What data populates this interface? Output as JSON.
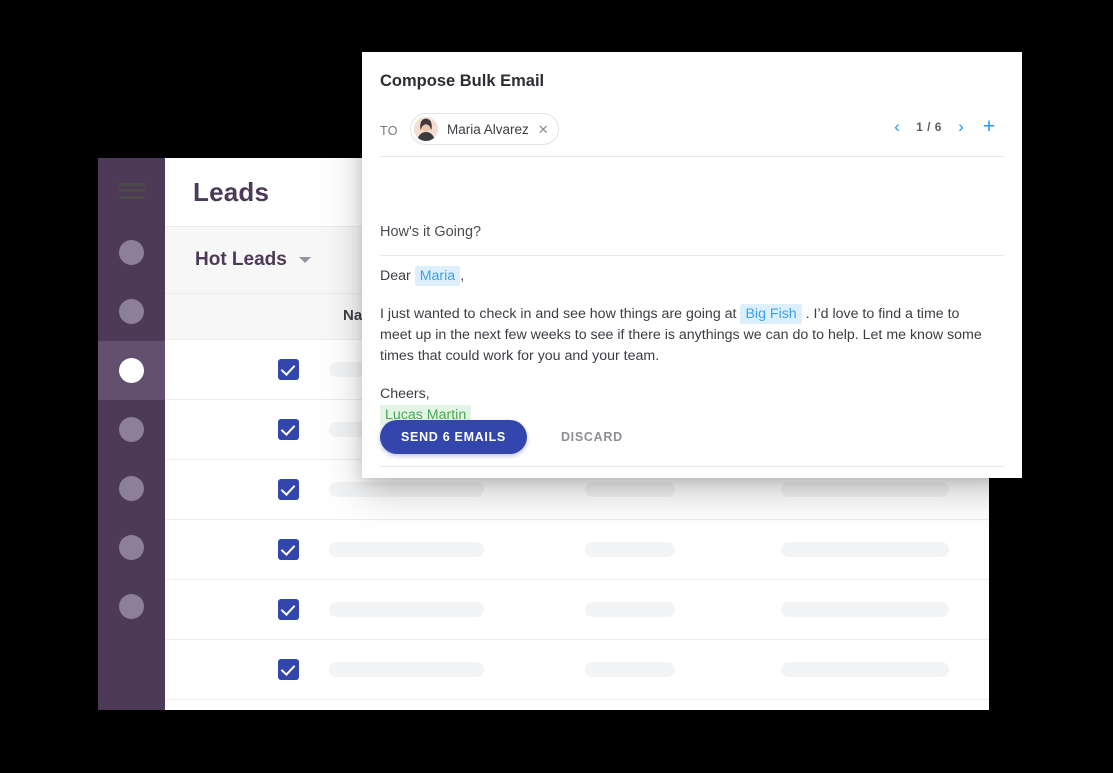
{
  "app": {
    "page_title": "Leads",
    "menu_icon": "hamburger-icon",
    "filter": {
      "label": "Hot Leads",
      "caret_icon": "chevron-down-icon"
    },
    "table": {
      "columns": [
        "Name"
      ],
      "row_count": 6,
      "rows_checked": true
    },
    "sidebar": {
      "items": [
        {
          "icon": "circle-avatar-icon",
          "active": false
        },
        {
          "icon": "circle-avatar-icon",
          "active": false
        },
        {
          "icon": "circle-avatar-icon",
          "active": true
        },
        {
          "icon": "circle-avatar-icon",
          "active": false
        },
        {
          "icon": "circle-avatar-icon",
          "active": false
        },
        {
          "icon": "circle-avatar-icon",
          "active": false
        },
        {
          "icon": "circle-avatar-icon",
          "active": false
        }
      ]
    }
  },
  "modal": {
    "title": "Compose Bulk Email",
    "to": {
      "label": "TO",
      "recipient_name": "Maria Alvarez",
      "remove_icon": "close-icon",
      "avatar": "user-photo-avatar"
    },
    "pager": {
      "prev_icon": "chevron-left-icon",
      "next_icon": "chevron-right-icon",
      "count": "1 / 6",
      "add_icon": "plus-icon"
    },
    "subject": "How's it Going?",
    "body": {
      "greeting_prefix": "Dear",
      "greeting_token": "Maria",
      "greeting_suffix": ",",
      "paragraph_part1": "I just wanted to check in and see how things are going at",
      "paragraph_token": "Big Fish",
      "paragraph_part2": ". I’d love to find a time to meet up in the next few weeks to see if there is anythings we can do to help. Let me know some times that could work for you and your team.",
      "signoff": "Cheers,",
      "signature_token": "Lucas Martin"
    },
    "actions": {
      "send_label": "SEND 6 EMAILS",
      "discard_label": "DISCARD"
    }
  },
  "colors": {
    "sidebar_bg": "#4c3a57",
    "sidebar_active": "#63506e",
    "brand_purple": "#4c3a57",
    "accent_blue": "#3246ae",
    "link_blue": "#2196f3",
    "token_blue_text": "#3ba1e8",
    "token_blue_bg": "#ddeefc",
    "token_green_text": "#4aa85a",
    "token_green_bg": "#e2f5e4"
  }
}
